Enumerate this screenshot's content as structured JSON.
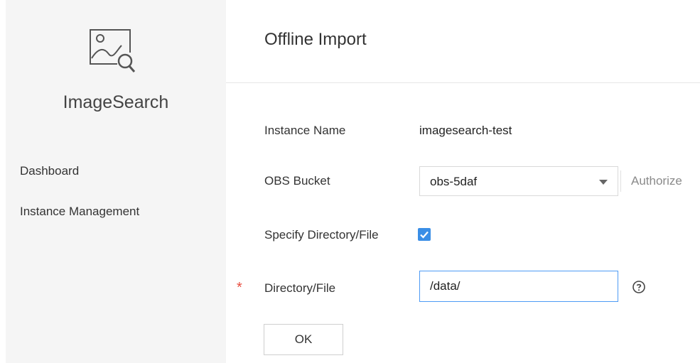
{
  "sidebar": {
    "logo_icon": "image-search-icon",
    "product_name": "ImageSearch",
    "items": [
      {
        "label": "Dashboard"
      },
      {
        "label": "Instance Management"
      }
    ]
  },
  "page": {
    "title": "Offline Import"
  },
  "form": {
    "instance_name": {
      "label": "Instance Name",
      "value": "imagesearch-test"
    },
    "obs_bucket": {
      "label": "OBS Bucket",
      "value": "obs-5daf",
      "authorize_label": "Authorize"
    },
    "specify_dir": {
      "label": "Specify Directory/File",
      "checked": true
    },
    "directory": {
      "label": "Directory/File",
      "required_mark": "*",
      "value": "/data/"
    },
    "ok_label": "OK"
  },
  "colors": {
    "accent": "#3a8ee6",
    "required": "#e84e40",
    "sidebar_bg": "#f5f5f5"
  }
}
